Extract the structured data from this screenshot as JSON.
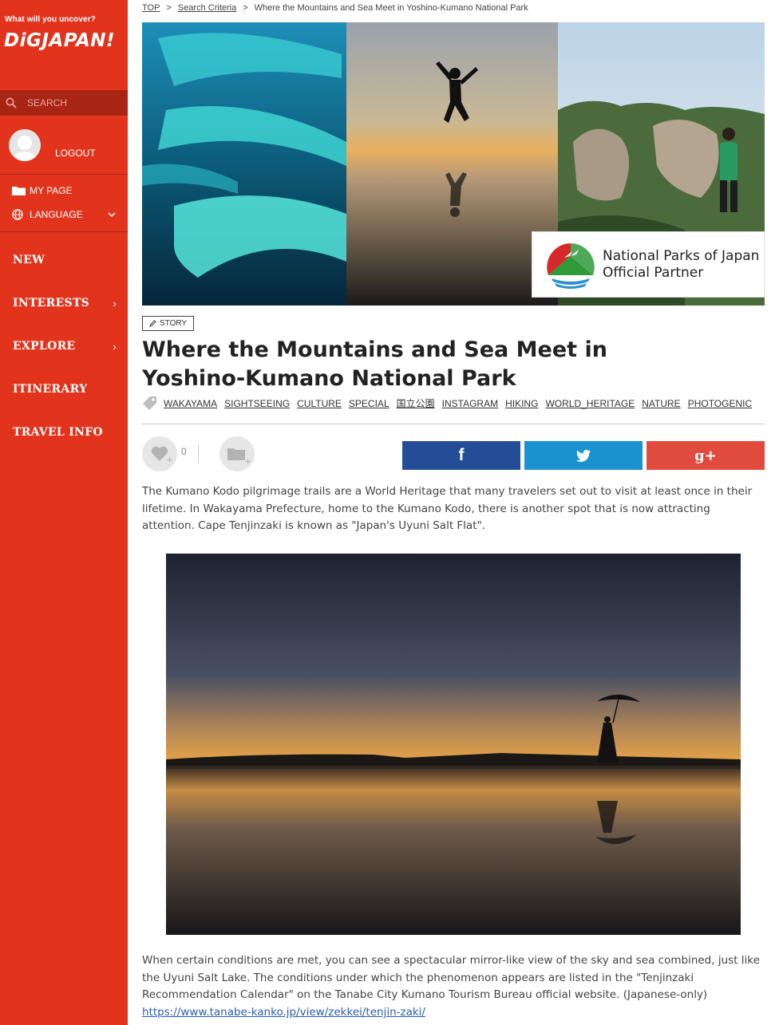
{
  "sidebar": {
    "tagline": "What will you uncover?",
    "logo": "DiGJAPAN!",
    "search_placeholder": "SEARCH",
    "logout": "LOGOUT",
    "my_page": "MY PAGE",
    "language": "LANGUAGE",
    "nav": [
      {
        "label": "NEW",
        "has_arrow": false
      },
      {
        "label": "INTERESTS",
        "has_arrow": true
      },
      {
        "label": "EXPLORE",
        "has_arrow": true
      },
      {
        "label": "ITINERARY",
        "has_arrow": false
      },
      {
        "label": "TRAVEL INFO",
        "has_arrow": false
      }
    ],
    "arrow": "›",
    "color": "#e2341d"
  },
  "breadcrumb": {
    "top": "TOP",
    "sep": ">",
    "search": "Search Criteria",
    "current": "Where the Mountains and Sea Meet in Yoshino-Kumano National Park"
  },
  "hero": {
    "badge_line1": "National Parks of Japan",
    "badge_line2": "Official Partner"
  },
  "article": {
    "category": "STORY",
    "title": "Where the Mountains and Sea Meet in Yoshino-Kumano National Park",
    "tags": [
      "WAKAYAMA",
      "SIGHTSEEING",
      "CULTURE",
      "SPECIAL",
      "国立公園",
      "INSTAGRAM",
      "HIKING",
      "WORLD_HERITAGE",
      "NATURE",
      "PHOTOGENIC"
    ],
    "like_count": "0",
    "share": {
      "facebook": "f",
      "google": "g+"
    },
    "paragraph1": "The Kumano Kodo pilgrimage trails are a World Heritage that many travelers set out to visit at least once in their lifetime. In Wakayama Prefecture, home to the Kumano Kodo, there is another spot that is now attracting attention. Cape Tenjinzaki is known as \"Japan's Uyuni Salt Flat\".",
    "paragraph2": "When certain conditions are met, you can see a spectacular mirror-like view of the sky and sea combined, just like the Uyuni Salt Lake. The conditions under which the phenomenon appears are listed in the \"Tenjinzaki Recommendation Calendar\" on the  Tanabe City Kumano Tourism Bureau official website.   (Japanese-only)",
    "link": "https://www.tanabe-kanko.jp/view/zekkei/tenjin-zaki/"
  },
  "colors": {
    "facebook": "#234e97",
    "twitter": "#1992cf",
    "google": "#e14b3d"
  }
}
